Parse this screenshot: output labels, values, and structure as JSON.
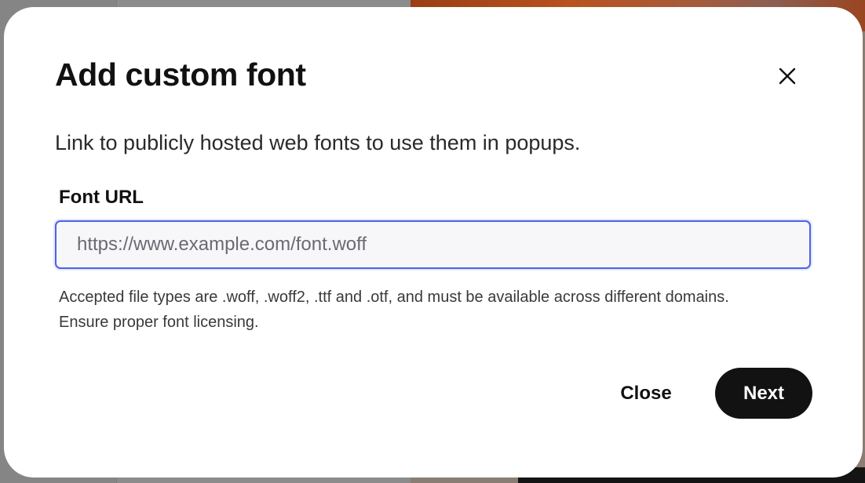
{
  "dialog": {
    "title": "Add custom font",
    "subtitle": "Link to publicly hosted web fonts to use them in popups.",
    "field_label": "Font URL",
    "url_input": {
      "value": "",
      "placeholder": "https://www.example.com/font.woff"
    },
    "help_text": "Accepted file types are .woff, .woff2, .ttf and .otf, and must be available across different domains. Ensure proper font licensing.",
    "close_label": "Close",
    "next_label": "Next",
    "close_icon": "close-icon"
  },
  "colors": {
    "primary_button": "#121212",
    "input_focus_border": "#4f63e0",
    "dialog_background": "#ffffff"
  }
}
